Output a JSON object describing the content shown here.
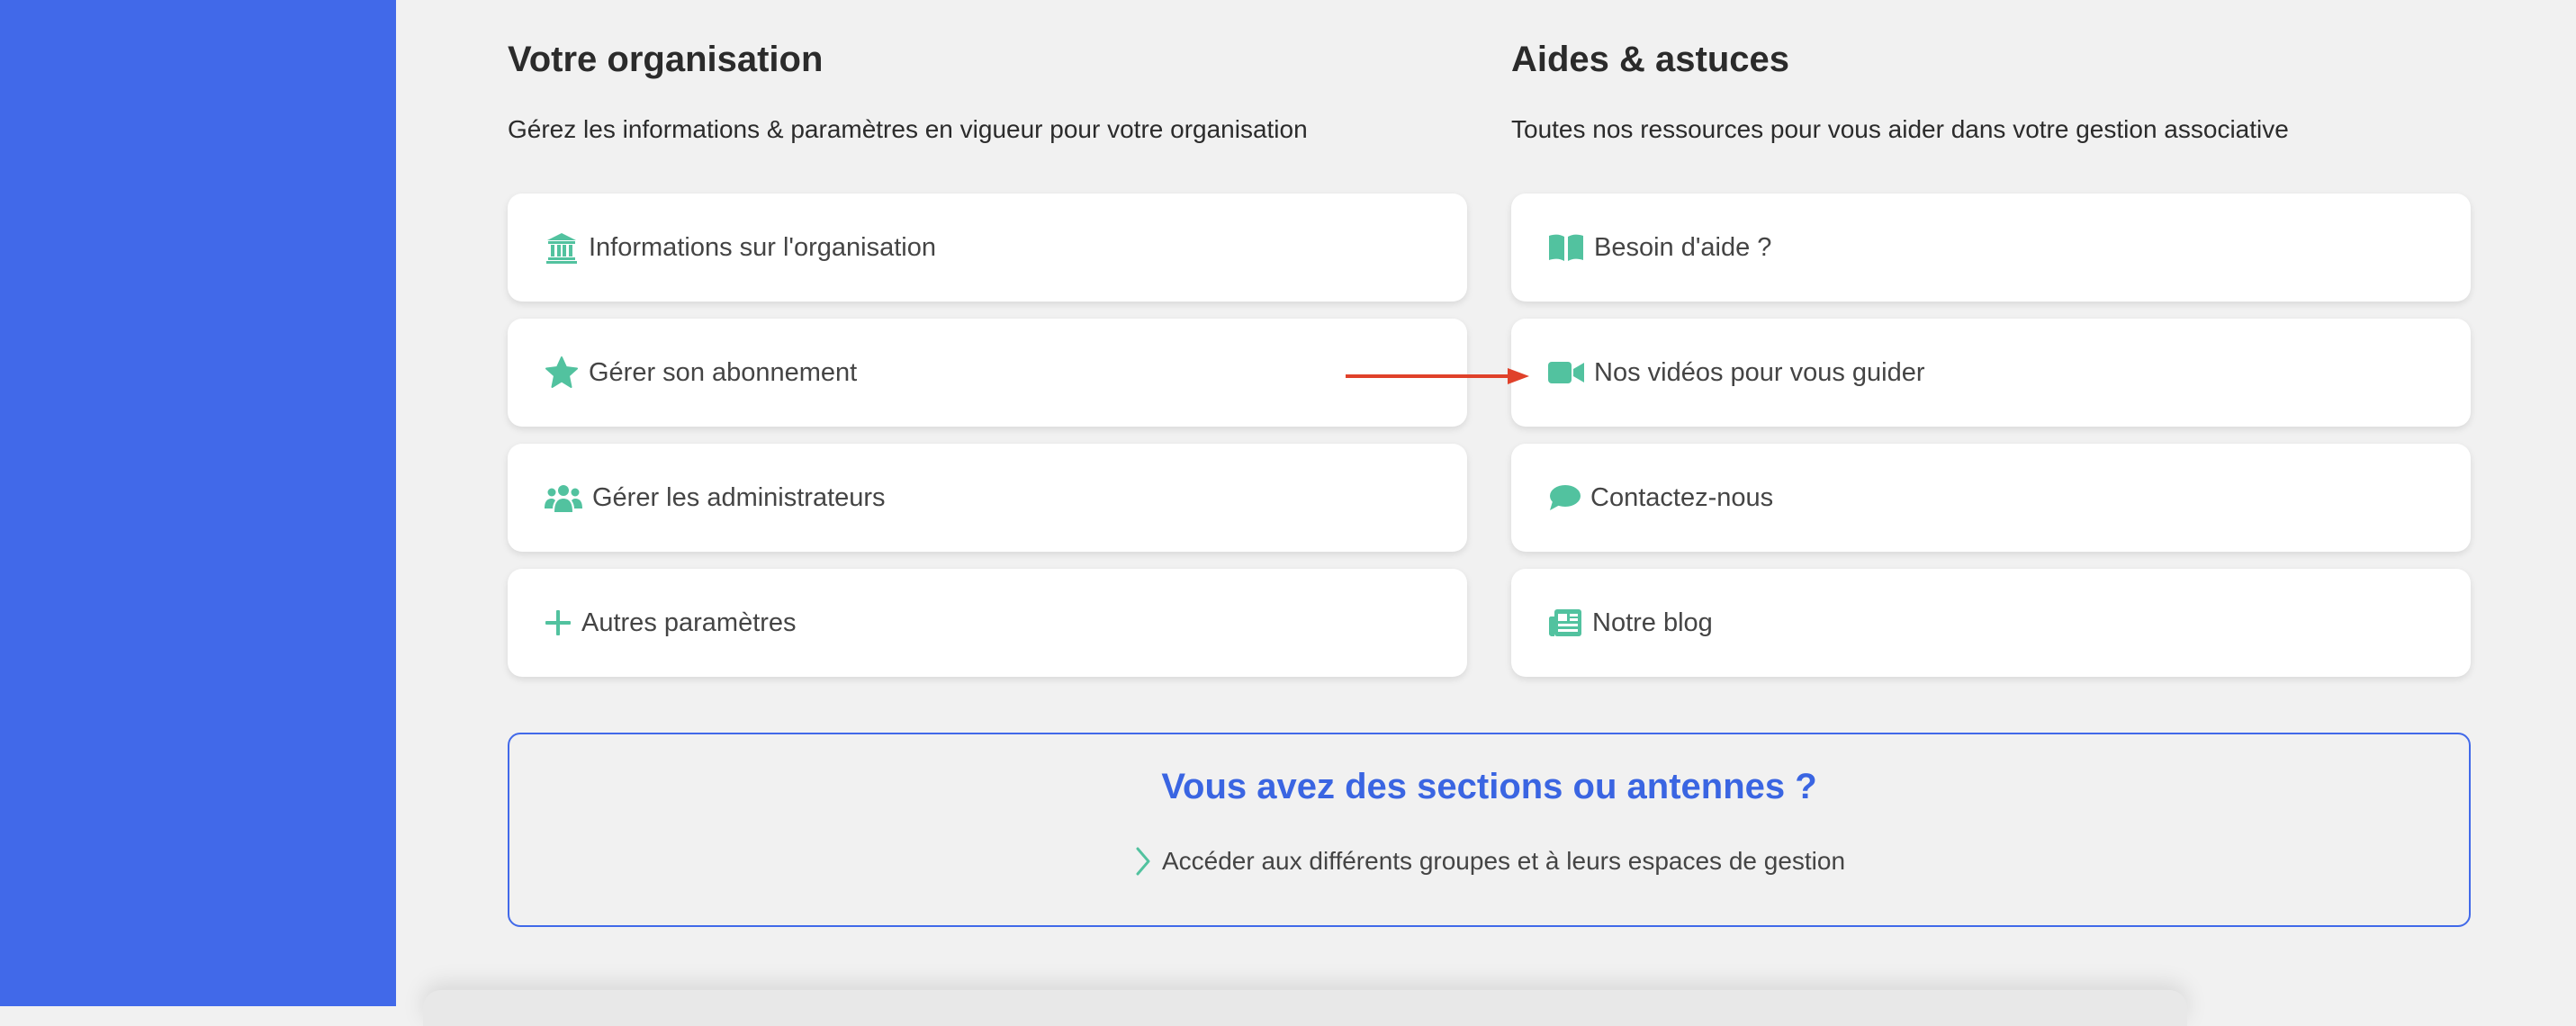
{
  "colors": {
    "sidebar": "#4169e9",
    "icon_accent": "#52c29f",
    "link_blue": "#3a65e2",
    "annotation_arrow": "#e0412a"
  },
  "organisation": {
    "title": "Votre organisation",
    "subtitle": "Gérez les informations & paramètres en vigueur pour votre organisation",
    "items": [
      {
        "label": "Informations sur l'organisation",
        "icon": "institution-icon"
      },
      {
        "label": "Gérer son abonnement",
        "icon": "star-icon"
      },
      {
        "label": "Gérer les administrateurs",
        "icon": "users-icon"
      },
      {
        "label": "Autres paramètres",
        "icon": "plus-icon"
      }
    ]
  },
  "help": {
    "title": "Aides & astuces",
    "subtitle": "Toutes nos ressources pour vous aider dans votre gestion associative",
    "items": [
      {
        "label": "Besoin d'aide ?",
        "icon": "book-icon"
      },
      {
        "label": "Nos vidéos pour vous guider",
        "icon": "video-camera-icon"
      },
      {
        "label": "Contactez-nous",
        "icon": "chat-bubble-icon"
      },
      {
        "label": "Notre blog",
        "icon": "newspaper-icon"
      }
    ]
  },
  "sections": {
    "title": "Vous avez des sections ou antennes ?",
    "link_label": "Accéder aux différents groupes et à leurs espaces de gestion"
  }
}
